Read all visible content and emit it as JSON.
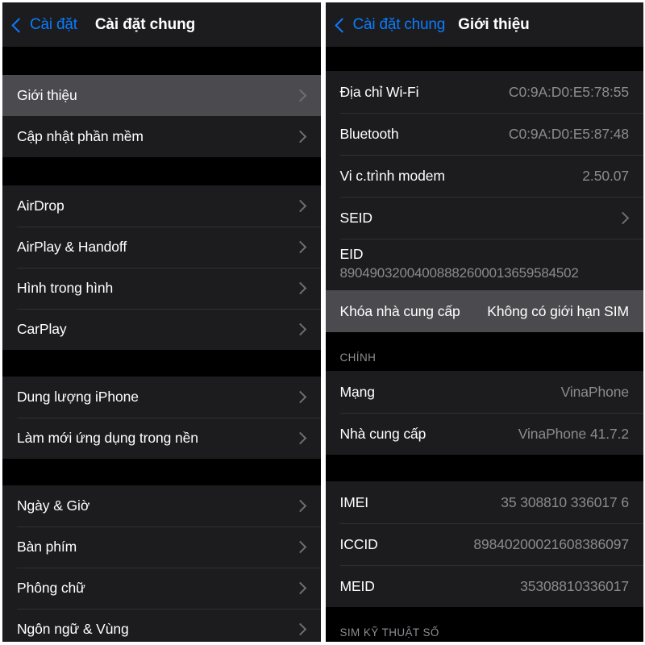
{
  "left": {
    "navbar": {
      "back_label": "Cài đặt",
      "back_icon": "chevron-left-icon",
      "title": "Cài đặt chung"
    },
    "groups": [
      {
        "rows": [
          {
            "label": "Giới thiệu",
            "accessory": "chevron-right-icon",
            "selected": true
          },
          {
            "label": "Cập nhật phần mềm",
            "accessory": "chevron-right-icon",
            "selected": false
          }
        ]
      },
      {
        "rows": [
          {
            "label": "AirDrop",
            "accessory": "chevron-right-icon",
            "selected": false
          },
          {
            "label": "AirPlay & Handoff",
            "accessory": "chevron-right-icon",
            "selected": false
          },
          {
            "label": "Hình trong hình",
            "accessory": "chevron-right-icon",
            "selected": false
          },
          {
            "label": "CarPlay",
            "accessory": "chevron-right-icon",
            "selected": false
          }
        ]
      },
      {
        "rows": [
          {
            "label": "Dung lượng iPhone",
            "accessory": "chevron-right-icon",
            "selected": false
          },
          {
            "label": "Làm mới ứng dụng trong nền",
            "accessory": "chevron-right-icon",
            "selected": false
          }
        ]
      },
      {
        "rows": [
          {
            "label": "Ngày & Giờ",
            "accessory": "chevron-right-icon",
            "selected": false
          },
          {
            "label": "Bàn phím",
            "accessory": "chevron-right-icon",
            "selected": false
          },
          {
            "label": "Phông chữ",
            "accessory": "chevron-right-icon",
            "selected": false
          },
          {
            "label": "Ngôn ngữ & Vùng",
            "accessory": "chevron-right-icon",
            "selected": false
          }
        ]
      }
    ]
  },
  "right": {
    "navbar": {
      "back_label": "Cài đặt chung",
      "back_icon": "chevron-left-icon",
      "title": "Giới thiệu"
    },
    "group1": {
      "rows": [
        {
          "label": "Địa chỉ Wi-Fi",
          "value": "C0:9A:D0:E5:78:55"
        },
        {
          "label": "Bluetooth",
          "value": "C0:9A:D0:E5:87:48"
        },
        {
          "label": "Vi c.trình modem",
          "value": "2.50.07"
        },
        {
          "label": "SEID",
          "accessory": "chevron-right-icon"
        },
        {
          "label": "EID",
          "sub": "89049032004008882600013659584502",
          "twoline": true
        },
        {
          "label": "Khóa nhà cung cấp",
          "value": "Không có giới hạn SIM",
          "selected": true
        }
      ]
    },
    "section_chinh": {
      "header": "CHÍNH",
      "rows": [
        {
          "label": "Mạng",
          "value": "VinaPhone"
        },
        {
          "label": "Nhà cung cấp",
          "value": "VinaPhone 41.7.2"
        }
      ]
    },
    "section_ids": {
      "rows": [
        {
          "label": "IMEI",
          "value": "35 308810 336017 6"
        },
        {
          "label": "ICCID",
          "value": "89840200021608386097"
        },
        {
          "label": "MEID",
          "value": "35308810336017"
        }
      ]
    },
    "section_esim": {
      "header": "SIM KỸ THUẬT SỐ"
    }
  },
  "colors": {
    "accent": "#0a7cff",
    "row_bg": "#1c1c1e",
    "row_selected_bg": "#4b4b4f",
    "page_bg": "#000000",
    "value_text": "#8b8b90",
    "header_text": "#8e8e93"
  }
}
